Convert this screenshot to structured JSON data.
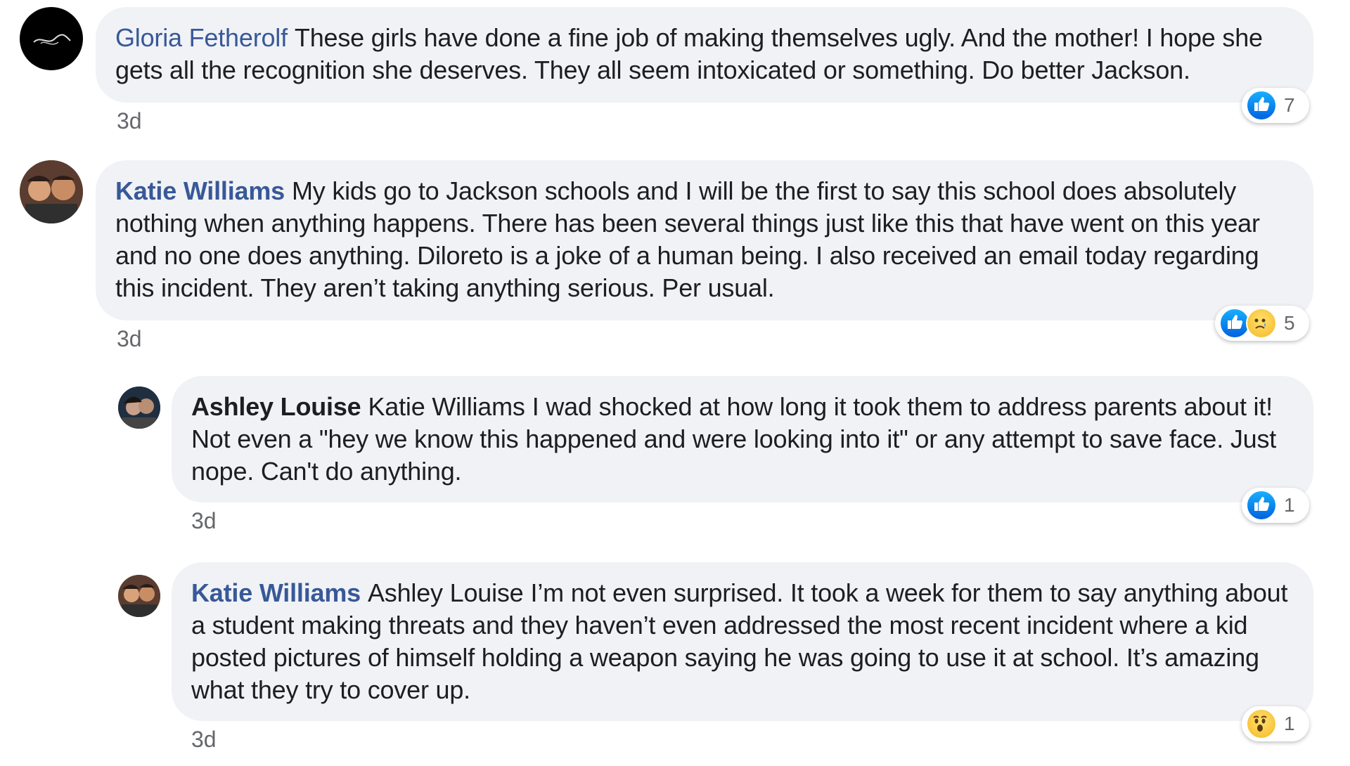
{
  "comments": [
    {
      "author": "Gloria Fetherolf",
      "author_style": "light",
      "mention": "",
      "text": "These girls have done a fine job of making themselves ugly. And the mother! I hope she gets all the recognition she deserves. They all seem intoxicated or something. Do better Jackson.",
      "time": "3d",
      "reactions": [
        "like"
      ],
      "reaction_count": "7"
    },
    {
      "author": "Katie Williams",
      "author_style": "bold",
      "mention": "",
      "text": "My kids go to Jackson schools and I will be the first to say this school does absolutely nothing when anything happens. There has been several things just like this that have went on this year and no one does anything. Diloreto is a joke of a human being. I also received an email today regarding this incident. They aren’t taking anything serious. Per usual.",
      "time": "3d",
      "reactions": [
        "like",
        "sad"
      ],
      "reaction_count": "5"
    },
    {
      "author": "Ashley Louise",
      "author_style": "dark",
      "mention": "Katie Williams",
      "text": "I wad shocked at how long it took them to address parents about it! Not even a \"hey we know this happened and were looking into it\" or any attempt to save face. Just nope. Can't do anything.",
      "time": "3d",
      "reactions": [
        "like"
      ],
      "reaction_count": "1"
    },
    {
      "author": "Katie Williams",
      "author_style": "bold",
      "mention": "Ashley Louise",
      "text": "I’m not even surprised. It took a week for them to say anything about a student making threats and they haven’t even addressed the most recent incident where a kid posted pictures of himself holding a weapon saying he was going to use it at school. It’s amazing what they try to cover up.",
      "time": "3d",
      "reactions": [
        "wow"
      ],
      "reaction_count": "1"
    }
  ],
  "icons": {
    "like": "like-reaction-icon",
    "sad": "sad-reaction-icon",
    "wow": "wow-reaction-icon"
  },
  "colors": {
    "bubble_bg": "#f0f2f5",
    "author_link": "#385898",
    "like_blue": "#1877f2",
    "timestamp": "#65676b"
  }
}
